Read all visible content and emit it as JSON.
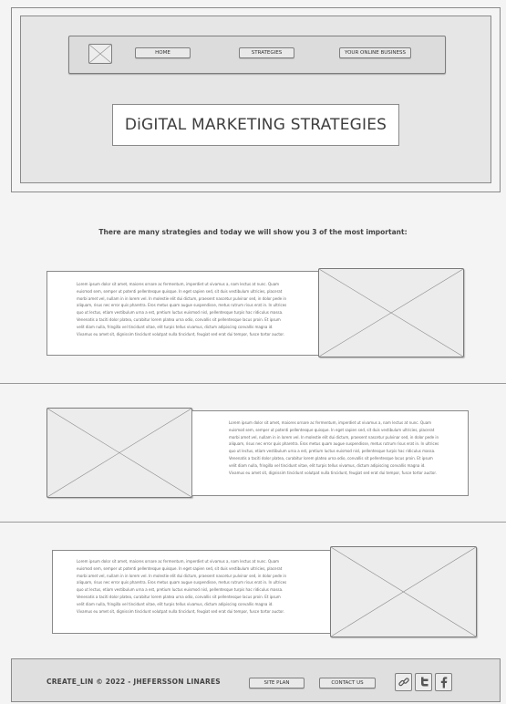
{
  "header": {
    "nav": {
      "home": "HOME",
      "strategies": "STRATEGIES",
      "business": "YOUR ONLINE BUSINESS"
    },
    "title": "DiGITAL MARKETING STRATEGIES"
  },
  "intro": "There are many strategies and today we will show you 3 of the most important:",
  "sections": [
    {
      "text": "Lorem ipsum dolor sit amet, maiores ornare ac fermentum, imperdiet ut vivamus a, nam lectus at nunc. Quam euismod sem, semper ut potenti pellentesque quisque. In eget sapien sed, sit duis vestibulum ultricies, placerat morbi amet vel, nullam in in lorem vel. In molestie elit dui dictum, praesent nascetur pulvinar sed, in dolor pede in aliquam, risus nec error quis pharetra. Eros metus quam augue suspendisse, metus rutrum risus erat in. In ultrices quo ut lectus, etiam vestibulum urna a est, pretium luctus euismod nisl, pellentesque turpis hac ridiculus massa. Venenatis a taciti dolor platea, curabitur lorem platea urna odio, convallis sit pellentesque lacus proin. Et ipsum velit diam nulla, fringilla vel tincidunt vitae, elit turpis tellus vivamus, dictum adipiscing convallis magna id. Vivamus eu amet sit, dignissim tincidunt volutpat nulla tincidunt, feugiat sed erat dui tempor, fusce tortor auctor."
    },
    {
      "text": "Lorem ipsum dolor sit amet, maiores ornare ac fermentum, imperdiet ut vivamus a, nam lectus at nunc. Quam euismod sem, semper ut potenti pellentesque quisque. In eget sapien sed, sit duis vestibulum ultricies, placerat morbi amet vel, nullam in in lorem vel. In molestie elit dui dictum, praesent nascetur pulvinar sed, in dolor pede in aliquam, risus nec error quis pharetra. Eros metus quam augue suspendisse, metus rutrum risus erat in. In ultrices quo ut lectus, etiam vestibulum urna a est, pretium luctus euismod nisl, pellentesque turpis hac ridiculus massa. Venenatis a taciti dolor platea, curabitur lorem platea urna odio, convallis sit pellentesque lacus proin. Et ipsum velit diam nulla, fringilla vel tincidunt vitae, elit turpis tellus vivamus, dictum adipiscing convallis magna id. Vivamus eu amet sit, dignissim tincidunt volutpat nulla tincidunt, feugiat sed erat dui tempor, fusce tortor auctor."
    },
    {
      "text": "Lorem ipsum dolor sit amet, maiores ornare ac fermentum, imperdiet ut vivamus a, nam lectus at nunc. Quam euismod sem, semper ut potenti pellentesque quisque. In eget sapien sed, sit duis vestibulum ultricies, placerat morbi amet vel, nullam in in lorem vel. In molestie elit dui dictum, praesent nascetur pulvinar sed, in dolor pede in aliquam, risus nec error quis pharetra. Eros metus quam augue suspendisse, metus rutrum risus erat in. In ultrices quo ut lectus, etiam vestibulum urna a est, pretium luctus euismod nisl, pellentesque turpis hac ridiculus massa. Venenatis a taciti dolor platea, curabitur lorem platea urna odio, convallis sit pellentesque lacus proin. Et ipsum velit diam nulla, fringilla vel tincidunt vitae, elit turpis tellus vivamus, dictum adipiscing convallis magna id. Vivamus eu amet sit, dignissim tincidunt volutpat nulla tincidunt, feugiat sed erat dui tempor, fusce tortor auctor."
    }
  ],
  "footer": {
    "copyright": "CREATE_LIN © 2022 - JHEFERSSON LINARES",
    "sitemap": "SITE PLAN",
    "contact": "CONTACT US",
    "social_icons": [
      "link-icon",
      "twitter-icon",
      "facebook-icon"
    ]
  }
}
